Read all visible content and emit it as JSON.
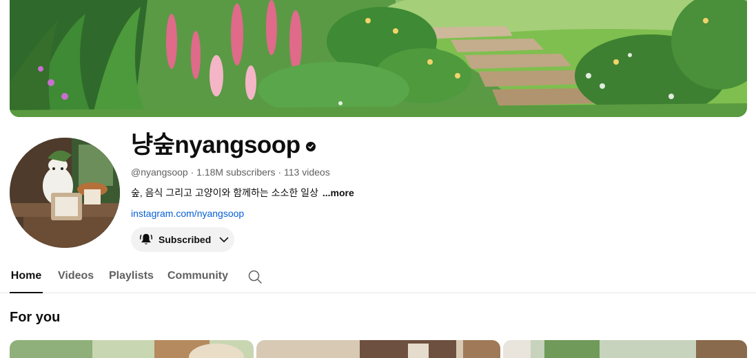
{
  "channel": {
    "name": "냥숲nyangsoop",
    "handle": "@nyangsoop",
    "subscribers": "1.18M subscribers",
    "videos": "113 videos",
    "separator": "·",
    "description": "숲, 음식 그리고 고양이와 함께하는 소소한 일상",
    "more_label": "...more",
    "link": "instagram.com/nyangsoop",
    "verified": true
  },
  "subscribe_button": {
    "label": "Subscribed",
    "bell_icon": "bell-filled-icon",
    "chevron_icon": "chevron-down-icon"
  },
  "tabs": [
    {
      "label": "Home",
      "active": true
    },
    {
      "label": "Videos",
      "active": false
    },
    {
      "label": "Playlists",
      "active": false
    },
    {
      "label": "Community",
      "active": false
    }
  ],
  "tab_search_icon": "search-icon",
  "sections": {
    "for_you": {
      "title": "For you"
    }
  },
  "colors": {
    "text_primary": "#0f0f0f",
    "text_secondary": "#606060",
    "link": "#065fd4",
    "button_bg": "#f2f2f2",
    "divider": "#e5e5e5"
  }
}
